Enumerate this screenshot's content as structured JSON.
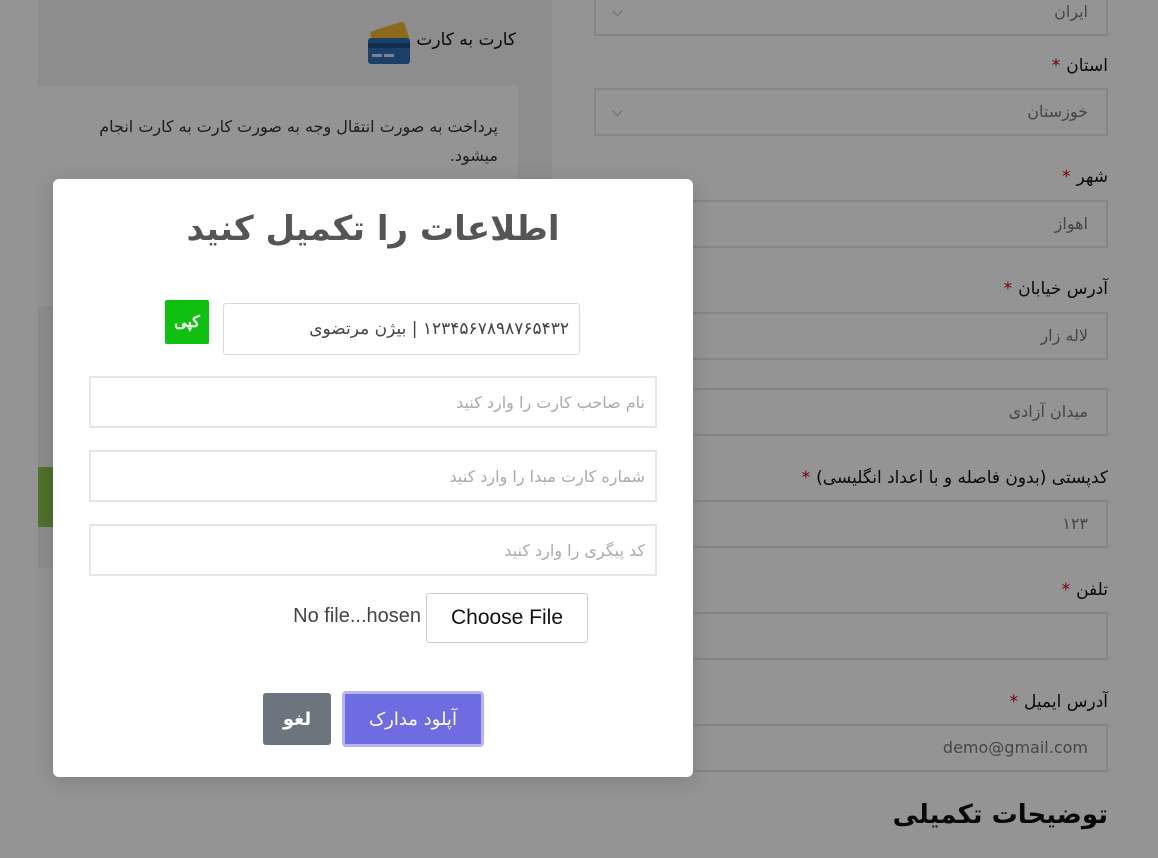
{
  "checkout": {
    "country_value": "ایران",
    "province": {
      "label": "استان",
      "value": "خوزستان"
    },
    "city": {
      "label": "شهر",
      "value": "اهواز"
    },
    "street": {
      "label": "آدرس خیابان",
      "value1": "لاله زار",
      "value2": "میدان آزادی"
    },
    "postcode": {
      "label": "کدپستی (بدون فاصله و با اعداد انگلیسی)",
      "value": "۱۲۳"
    },
    "phone": {
      "label": "تلفن",
      "value": ""
    },
    "email": {
      "label": "آدرس ایمیل",
      "value": "demo@gmail.com"
    },
    "required_mark": "*",
    "extra_section_title": "توضیحات تکمیلی"
  },
  "payment": {
    "method_label": "کارت به کارت",
    "method_icon": "credit-card-icon",
    "description": "پرداخت به صورت انتقال وجه به صورت کارت به کارت انجام میشود."
  },
  "modal": {
    "title": "اطلاعات را تکمیل کنید",
    "account_info": "۱۲۳۴۵۶۷۸۹۸۷۶۵۴۳۲ | بیژن مرتضوی",
    "copy_label": "کپی",
    "holder_placeholder": "نام صاحب کارت را وارد کنید",
    "card_number_placeholder": "شماره کارت مبدا را وارد کنید",
    "tracking_placeholder": "کد پیگری را وارد کنید",
    "file_button_label": "Choose File",
    "file_status": "No file...hosen",
    "upload_label": "آپلود مدارک",
    "cancel_label": "لغو",
    "colors": {
      "primary": "#6f6be0",
      "copy": "#10c010",
      "cancel": "#6c757d"
    }
  }
}
